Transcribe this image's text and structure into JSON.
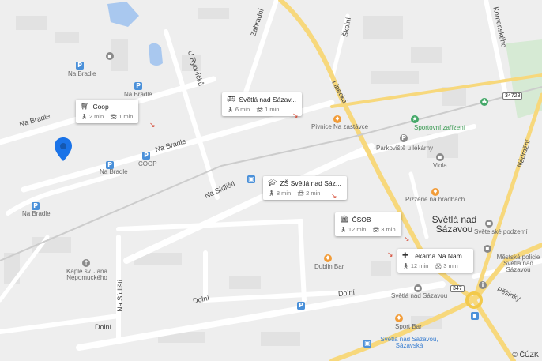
{
  "labels": {
    "na_bradle_1": "Na Bradle",
    "na_bradle_2": "Na Bradle",
    "na_bradle_3": "Na Bradle",
    "na_bradle_4": "Na Bradle",
    "na_bradle_5": "Na Bradle",
    "coop": "COOP",
    "u_rybnicku": "U Rybníčků",
    "zahradni": "Zahradní",
    "skolni": "Školní",
    "komenskeho": "Komenského",
    "lipecka": "Lipecká",
    "nadrazni": "Nádražní",
    "na_sidlisti_1": "Na Sídlišti",
    "na_sidlisti_2": "Na Sídlišti",
    "dolni_1": "Dolní",
    "dolni_2": "Dolní",
    "dolni_3": "Dolní",
    "pivnice": "Pivnice Na zastávce",
    "parkoviste": "Parkoviště u lékárny",
    "sportovni": "Sportovní zařízení",
    "viola": "Viola",
    "pizzerie": "Pizzerie na hradbách",
    "town": "Světlá nad Sázavou",
    "svetelske_podzemi": "Světelské podzemí",
    "mestska_policie": "Městská policie Světlá nad Sázavou",
    "pesinky": "Pěšinky",
    "dublin_bar": "Dublin Bar",
    "kaple": "Kaple sv. Jana Nepomuckého",
    "vetrina": "Světlá nad Sázavou",
    "sport_bar": "Sport Bar",
    "station": "Světlá nad Sázavou, Sázavská",
    "road_34728": "34728",
    "road_347": "347"
  },
  "cards": [
    {
      "title": "Coop",
      "icon": "cart-icon",
      "walk": "2 min",
      "drive": "1 min"
    },
    {
      "title": "Světlá nad Sázav...",
      "icon": "bus-icon",
      "walk": "6 min",
      "drive": "1 min"
    },
    {
      "title": "ZŠ Světlá nad Sáz...",
      "icon": "school-icon",
      "walk": "8 min",
      "drive": "2 min"
    },
    {
      "title": "ČSOB",
      "icon": "bank-icon",
      "walk": "12 min",
      "drive": "3 min"
    },
    {
      "title": "Lékárna Na Nam...",
      "icon": "pharmacy-icon",
      "walk": "12 min",
      "drive": "3 min"
    }
  ],
  "copyright": "© ČÚZK",
  "colors": {
    "pin": "#1a73e8",
    "arrow": "#d4432e",
    "main_road": "#f7d87c",
    "water": "#a9c8ef",
    "green": "#c7e5c7"
  }
}
